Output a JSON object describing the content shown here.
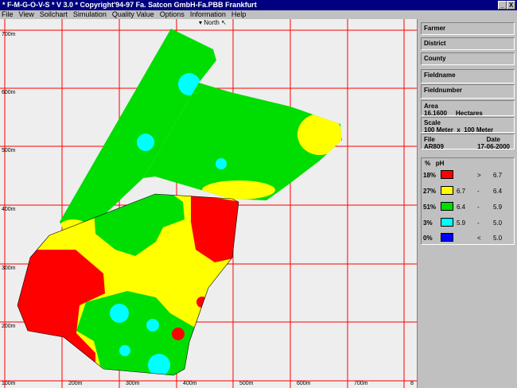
{
  "window": {
    "title": "* F-M-G-O-V-S * V 3.0 * Copyright'94-97  Fa. Satcon GmbH-Fa.PBB Frankfurt",
    "minimize_glyph": "_",
    "close_glyph": "X"
  },
  "menu": [
    "File",
    "View",
    "Soilchart",
    "Simulation",
    "Quality Value",
    "Options",
    "Information",
    "Help"
  ],
  "map": {
    "north_label": "North",
    "y_ticks": [
      "700m",
      "600m",
      "500m",
      "400m",
      "300m",
      "200m",
      "100m"
    ],
    "x_ticks": [
      "200m",
      "300m",
      "400m",
      "500m",
      "600m",
      "700m",
      "8"
    ],
    "colors": {
      "red": "#ff0000",
      "yellow": "#ffff00",
      "green": "#00dd00",
      "cyan": "#00ffff",
      "grid": "#ff0000"
    }
  },
  "panel": {
    "farmer": "Farmer",
    "district": "District",
    "county": "County",
    "fieldname": "Fieldname",
    "fieldnumber": "Fieldnumber",
    "area_label": "Area",
    "area_value": "16.1600     Hectares",
    "scale_label": "Scale",
    "scale_value": "100 Meter  x  100 Meter",
    "file_label": "File",
    "file_value": "AR809",
    "date_label": "Date",
    "date_value": "17-06-2000"
  },
  "legend": {
    "header": "%   pH",
    "rows": [
      {
        "pct": "18%",
        "color": "#ff0000",
        "v1": "",
        "op": ">",
        "v2": "6.7"
      },
      {
        "pct": "27%",
        "color": "#ffff00",
        "v1": "6.7",
        "op": "-",
        "v2": "6.4"
      },
      {
        "pct": "51%",
        "color": "#00dd00",
        "v1": "6.4",
        "op": "-",
        "v2": "5.9"
      },
      {
        "pct": "3%",
        "color": "#00ffff",
        "v1": "5.9",
        "op": "-",
        "v2": "5.0"
      },
      {
        "pct": "0%",
        "color": "#0000ff",
        "v1": "",
        "op": "<",
        "v2": "5.0"
      }
    ]
  }
}
